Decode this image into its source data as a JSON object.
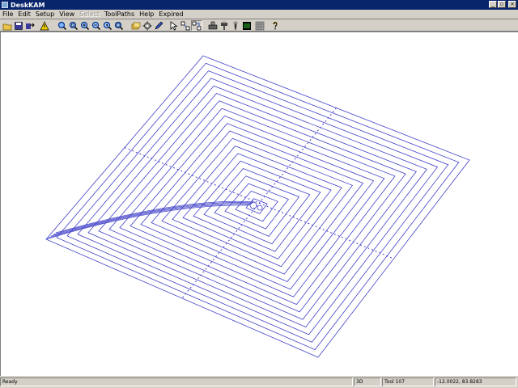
{
  "window": {
    "title": "DeskKAM",
    "minimize_label": "_",
    "maximize_label": "▫",
    "close_label": "×"
  },
  "menu": {
    "items": [
      {
        "label": "File",
        "enabled": true
      },
      {
        "label": "Edit",
        "enabled": true
      },
      {
        "label": "Setup",
        "enabled": true
      },
      {
        "label": "View",
        "enabled": true
      },
      {
        "label": "Select",
        "enabled": false
      },
      {
        "label": "ToolPaths",
        "enabled": true
      },
      {
        "label": "Help",
        "enabled": true
      },
      {
        "label": "Expired",
        "enabled": true
      }
    ]
  },
  "toolbar": {
    "buttons": [
      {
        "icon": "open-folder-icon"
      },
      {
        "icon": "save-icon"
      },
      {
        "icon": "export-icon"
      },
      {
        "icon": "warning-icon"
      },
      {
        "icon": "zoom-all-icon"
      },
      {
        "icon": "zoom-window-icon"
      },
      {
        "icon": "zoom-in-icon"
      },
      {
        "icon": "zoom-out-icon"
      },
      {
        "icon": "zoom-previous-icon"
      },
      {
        "icon": "zoom-extents-icon"
      },
      {
        "icon": "layers-icon"
      },
      {
        "icon": "settings-icon"
      },
      {
        "icon": "pen-icon"
      },
      {
        "icon": "pointer-icon"
      },
      {
        "icon": "select-nodes-icon"
      },
      {
        "icon": "select-chain-icon"
      },
      {
        "icon": "machine-icon"
      },
      {
        "icon": "drill-icon"
      },
      {
        "icon": "tool-icon"
      },
      {
        "icon": "simulate-icon"
      },
      {
        "icon": "grid-icon"
      },
      {
        "icon": "help-icon"
      }
    ]
  },
  "status": {
    "message": "Ready",
    "mode": "3D",
    "tool": "Tool 107",
    "coordinates": "-12.0022, 83.8283"
  },
  "colors": {
    "title_bar": "#08246b",
    "toolpath": "#4040c8",
    "canvas": "#ffffff"
  }
}
